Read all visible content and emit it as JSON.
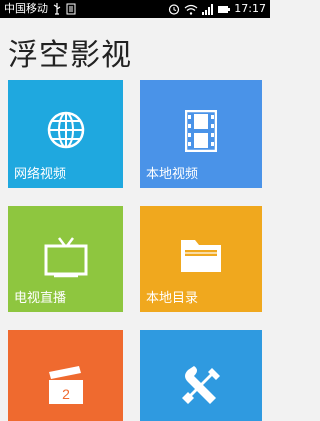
{
  "status_bar": {
    "carrier": "中国移动",
    "time": "17:17"
  },
  "app": {
    "title": "浮空影视"
  },
  "tiles": [
    {
      "label": "网络视频",
      "icon": "globe-icon",
      "color": "#1fa8df"
    },
    {
      "label": "本地视频",
      "icon": "film-strip-icon",
      "color": "#4a93e8"
    },
    {
      "label": "电视直播",
      "icon": "tv-icon",
      "color": "#8ec63f"
    },
    {
      "label": "本地目录",
      "icon": "folder-icon",
      "color": "#f0a81e"
    },
    {
      "label": "",
      "icon": "clapperboard-icon",
      "color": "#ef6a2f"
    },
    {
      "label": "",
      "icon": "tools-icon",
      "color": "#2f9ae0"
    }
  ]
}
